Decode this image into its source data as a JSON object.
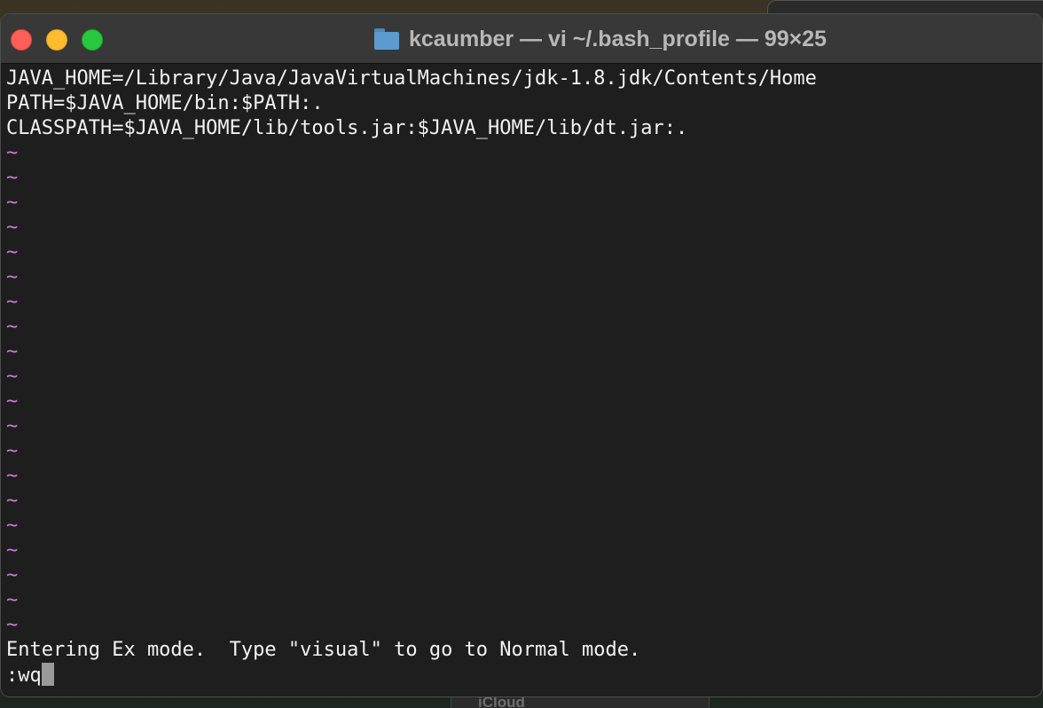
{
  "window": {
    "title": "kcaumber — vi ~/.bash_profile — 99×25",
    "folder_icon": "folder-icon"
  },
  "background": {
    "panel_label": "iCloud"
  },
  "editor": {
    "lines": [
      "JAVA_HOME=/Library/Java/JavaVirtualMachines/jdk-1.8.jdk/Contents/Home",
      "PATH=$JAVA_HOME/bin:$PATH:.",
      "CLASSPATH=$JAVA_HOME/lib/tools.jar:$JAVA_HOME/lib/dt.jar:."
    ],
    "empty_line_marker": "~",
    "empty_line_count": 20,
    "status_message": "Entering Ex mode.  Type \"visual\" to go to Normal mode.",
    "command_line": ":wq"
  },
  "colors": {
    "tilde": "#c97ad6",
    "text": "#f2f2f2",
    "terminal_bg": "#1e1e1e",
    "close": "#ff5f57",
    "minimize": "#febc2e",
    "maximize": "#28c840"
  }
}
